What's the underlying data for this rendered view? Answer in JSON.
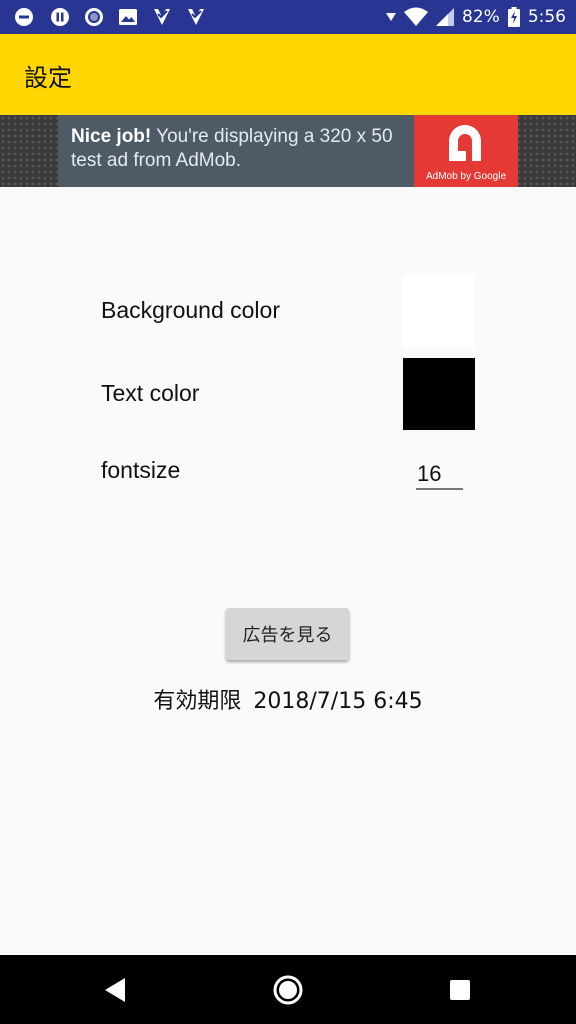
{
  "status_bar": {
    "battery": "82%",
    "time": "5:56",
    "left_icons": [
      "minus-circle-icon",
      "pause-circle-icon",
      "record-circle-icon",
      "image-icon",
      "check-tag-icon",
      "check-tag-icon"
    ],
    "right_icons": [
      "wifi-icon",
      "signal-icon",
      "battery-charging-icon"
    ],
    "background": "#283593"
  },
  "app_bar": {
    "title": "設定",
    "background": "#ffd600"
  },
  "ad_banner": {
    "headline": "Nice job!",
    "body": " You're displaying a 320 x 50 test ad from AdMob.",
    "logo_caption": "AdMob by Google",
    "logo_color": "#e53935"
  },
  "settings": {
    "background_color_label": "Background color",
    "background_color_value": "#ffffff",
    "text_color_label": "Text color",
    "text_color_value": "#000000",
    "fontsize_label": "fontsize",
    "fontsize_value": "16"
  },
  "watch_ad_button": "広告を見る",
  "expiry": {
    "label": "有効期限",
    "value": "2018/7/15 6:45"
  },
  "nav_bar": {
    "icons": [
      "back-icon",
      "home-icon",
      "recents-icon"
    ]
  }
}
